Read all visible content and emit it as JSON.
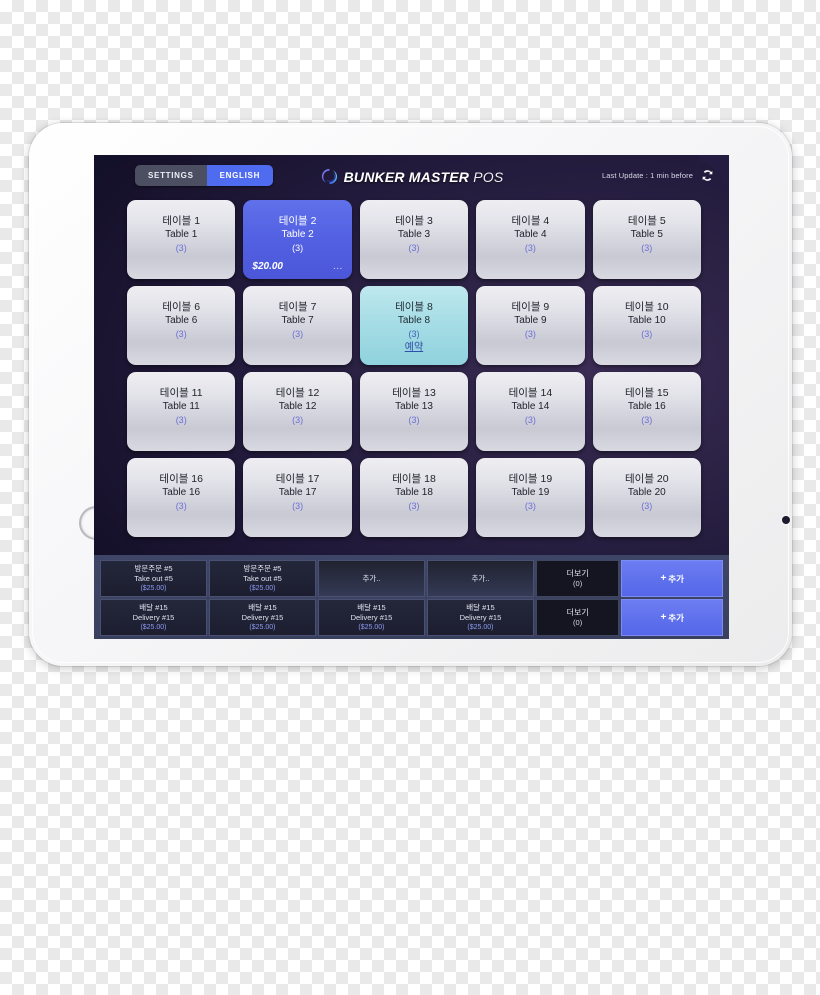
{
  "header": {
    "settings_label": "SETTINGS",
    "english_label": "ENGLISH",
    "brand_bold": "BUNKER MASTER",
    "brand_light": "POS",
    "brand_icon": "aperture-swirl-icon",
    "update_text": "Last Update : 1 min before",
    "refresh_icon": "refresh-icon"
  },
  "colors": {
    "accent_blue": "#4f6bf0",
    "busy_blue": "#5260e2",
    "reserved_cyan": "#a7dde6",
    "free_gray": "#e3e3ea",
    "strip_bg": "#3e4566",
    "screen_bg": "#20193a"
  },
  "tables": [
    {
      "ko": "테이블 1",
      "en": "Table 1",
      "count": "(3)",
      "state": "free"
    },
    {
      "ko": "테이블 2",
      "en": "Table 2",
      "count": "(3)",
      "state": "busy",
      "amount": "$20.00",
      "dots": "..."
    },
    {
      "ko": "테이블 3",
      "en": "Table 3",
      "count": "(3)",
      "state": "free"
    },
    {
      "ko": "테이블 4",
      "en": "Table 4",
      "count": "(3)",
      "state": "free"
    },
    {
      "ko": "테이블 5",
      "en": "Table 5",
      "count": "(3)",
      "state": "free"
    },
    {
      "ko": "테이블 6",
      "en": "Table 6",
      "count": "(3)",
      "state": "free"
    },
    {
      "ko": "테이블 7",
      "en": "Table 7",
      "count": "(3)",
      "state": "free"
    },
    {
      "ko": "테이블 8",
      "en": "Table 8",
      "count": "(3)",
      "state": "reserved",
      "reserved_label": "예약"
    },
    {
      "ko": "테이블 9",
      "en": "Table 9",
      "count": "(3)",
      "state": "free"
    },
    {
      "ko": "테이블 10",
      "en": "Table 10",
      "count": "(3)",
      "state": "free"
    },
    {
      "ko": "테이블 11",
      "en": "Table 11",
      "count": "(3)",
      "state": "free"
    },
    {
      "ko": "테이블 12",
      "en": "Table 12",
      "count": "(3)",
      "state": "free"
    },
    {
      "ko": "테이블 13",
      "en": "Table 13",
      "count": "(3)",
      "state": "free"
    },
    {
      "ko": "테이블 14",
      "en": "Table 14",
      "count": "(3)",
      "state": "free"
    },
    {
      "ko": "테이블 15",
      "en": "Table 16",
      "count": "(3)",
      "state": "free"
    },
    {
      "ko": "테이블 16",
      "en": "Table 16",
      "count": "(3)",
      "state": "free"
    },
    {
      "ko": "테이블 17",
      "en": "Table 17",
      "count": "(3)",
      "state": "free"
    },
    {
      "ko": "테이블 18",
      "en": "Table 18",
      "count": "(3)",
      "state": "free"
    },
    {
      "ko": "테이블 19",
      "en": "Table 19",
      "count": "(3)",
      "state": "free"
    },
    {
      "ko": "테이블 20",
      "en": "Table 20",
      "count": "(3)",
      "state": "free"
    }
  ],
  "order_rows": [
    {
      "name": "takeout-row",
      "cells": [
        {
          "type": "order",
          "ko": "방문주문 #5",
          "en": "Take out #5",
          "amount": "($25.00)"
        },
        {
          "type": "order",
          "ko": "방문주문 #5",
          "en": "Take out #5",
          "amount": "($25.00)"
        },
        {
          "type": "plain",
          "ko": "추가.."
        },
        {
          "type": "plain",
          "ko": "추가.."
        },
        {
          "type": "more",
          "ko": "더보기",
          "count": "(0)"
        },
        {
          "type": "add",
          "plus": "+",
          "ko": "추가"
        }
      ]
    },
    {
      "name": "delivery-row",
      "cells": [
        {
          "type": "order",
          "ko": "배달 #15",
          "en": "Delivery #15",
          "amount": "($25.00)"
        },
        {
          "type": "order",
          "ko": "배달 #15",
          "en": "Delivery #15",
          "amount": "($25.00)"
        },
        {
          "type": "order",
          "ko": "배달 #15",
          "en": "Delivery #15",
          "amount": "($25.00)"
        },
        {
          "type": "order",
          "ko": "배달 #15",
          "en": "Delivery #15",
          "amount": "($25.00)"
        },
        {
          "type": "more",
          "ko": "더보기",
          "count": "(0)"
        },
        {
          "type": "add",
          "plus": "+",
          "ko": "추가"
        }
      ]
    }
  ],
  "device": {
    "home_button": "home-button",
    "camera": "front-camera-dot"
  }
}
